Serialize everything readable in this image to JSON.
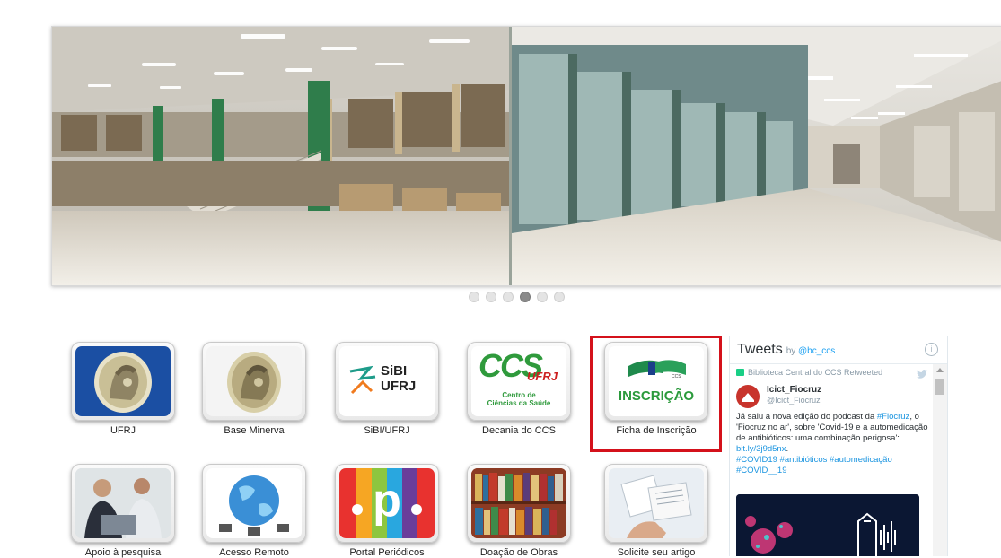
{
  "carousel": {
    "dot_count": 6,
    "active_index": 3
  },
  "tiles": [
    {
      "label": "UFRJ",
      "icon": "ufrj-crest-icon"
    },
    {
      "label": "Base Minerva",
      "icon": "minerva-crest-icon"
    },
    {
      "label": "SiBI/UFRJ",
      "icon": "sibi-logo-icon",
      "logo_top": "SiBI",
      "logo_bottom": "UFRJ"
    },
    {
      "label": "Decania do CCS",
      "icon": "ccs-logo-icon",
      "logo_main": "CCS",
      "logo_sub": "UFRJ",
      "logo_caption1": "Centro de",
      "logo_caption2": "Ciências da Saúde"
    },
    {
      "label": "Ficha de Inscrição",
      "icon": "bc-inscricao-icon",
      "logo_text": "INSCRIÇÃO",
      "logo_mini": "CCS"
    },
    {
      "label": "Apoio à pesquisa",
      "icon": "research-photo-icon"
    },
    {
      "label": "Acesso Remoto",
      "icon": "globe-network-icon"
    },
    {
      "label": "Portal Periódicos",
      "icon": "periodicos-logo-icon",
      "logo_text": "p"
    },
    {
      "label": "Doação de Obras",
      "icon": "bookshelf-photo-icon"
    },
    {
      "label": "Solicite seu artigo",
      "icon": "documents-photo-icon"
    }
  ],
  "tweets": {
    "title": "Tweets",
    "by": "by",
    "handle": "@bc_ccs",
    "info": "i",
    "retweeted_by": "Biblioteca Central do CCS Retweeted",
    "author_name": "Icict_Fiocruz",
    "author_handle": "@Icict_Fiocruz",
    "text_1": "Já saiu a nova edição do podcast da ",
    "tag_fiocruz": "#Fiocruz",
    "text_2": ", o 'Fiocruz no ar', sobre 'Covid-19 e a automedicação de antibióticos: uma combinação perigosa': ",
    "link": "bit.ly/3j9d5nx",
    "text_3": ".",
    "hashtags": "#COVID19 #antibióticos #automedicação #COVID__19"
  },
  "colors": {
    "highlight": "#d4111b",
    "twitter_blue": "#1da1f2",
    "retweet_green": "#19cf86"
  }
}
